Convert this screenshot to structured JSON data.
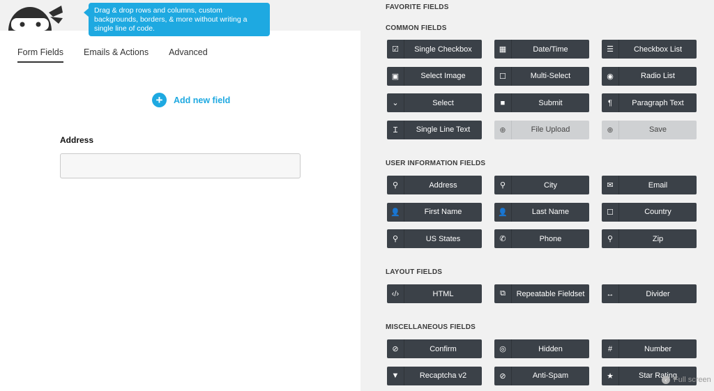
{
  "tooltip": {
    "line1": "Drag & drop rows and columns, custom",
    "line2": "backgrounds, borders, & more without writing a",
    "line3": "single line of code."
  },
  "tabs": [
    "Form Fields",
    "Emails & Actions",
    "Advanced"
  ],
  "add_field_label": "Add new field",
  "address_label": "Address",
  "sections": {
    "favorite": "FAVORITE FIELDS",
    "common": "COMMON FIELDS",
    "user_info": "USER INFORMATION FIELDS",
    "layout": "LAYOUT FIELDS",
    "misc": "MISCELLANEOUS FIELDS"
  },
  "common_fields": [
    {
      "label": "Single Checkbox",
      "icon": "checkbox-icon"
    },
    {
      "label": "Date/Time",
      "icon": "calendar-icon"
    },
    {
      "label": "Checkbox List",
      "icon": "list-icon"
    },
    {
      "label": "Select Image",
      "icon": "image-icon"
    },
    {
      "label": "Multi-Select",
      "icon": "square-icon"
    },
    {
      "label": "Radio List",
      "icon": "radio-icon"
    },
    {
      "label": "Select",
      "icon": "chevron-down-icon"
    },
    {
      "label": "Submit",
      "icon": "square-filled-icon"
    },
    {
      "label": "Paragraph Text",
      "icon": "paragraph-icon"
    },
    {
      "label": "Single Line Text",
      "icon": "text-cursor-icon"
    },
    {
      "label": "File Upload",
      "icon": "upload-icon",
      "disabled": true
    },
    {
      "label": "Save",
      "icon": "save-icon",
      "disabled": true
    }
  ],
  "user_info_fields": [
    {
      "label": "Address",
      "icon": "map-pin-icon"
    },
    {
      "label": "City",
      "icon": "map-pin-icon"
    },
    {
      "label": "Email",
      "icon": "envelope-icon"
    },
    {
      "label": "First Name",
      "icon": "user-icon"
    },
    {
      "label": "Last Name",
      "icon": "user-icon"
    },
    {
      "label": "Country",
      "icon": "square-icon"
    },
    {
      "label": "US States",
      "icon": "map-pin-icon"
    },
    {
      "label": "Phone",
      "icon": "phone-icon"
    },
    {
      "label": "Zip",
      "icon": "map-pin-icon"
    }
  ],
  "layout_fields": [
    {
      "label": "HTML",
      "icon": "code-icon"
    },
    {
      "label": "Repeatable Fieldset",
      "icon": "copy-icon"
    },
    {
      "label": "Divider",
      "icon": "arrows-horizontal-icon"
    }
  ],
  "misc_fields": [
    {
      "label": "Confirm",
      "icon": "check-circle-icon"
    },
    {
      "label": "Hidden",
      "icon": "eye-slash-icon"
    },
    {
      "label": "Number",
      "icon": "hash-icon"
    },
    {
      "label": "Recaptcha v2",
      "icon": "filter-icon"
    },
    {
      "label": "Anti-Spam",
      "icon": "ban-icon"
    },
    {
      "label": "Star Rating",
      "icon": "star-icon"
    }
  ],
  "fullscreen_label": "Full screen",
  "colors": {
    "accent": "#1ea9e1",
    "button_bg": "#3b4148",
    "button_disabled_bg": "#cfd1d3",
    "panel_bg": "#f1f1f1"
  }
}
